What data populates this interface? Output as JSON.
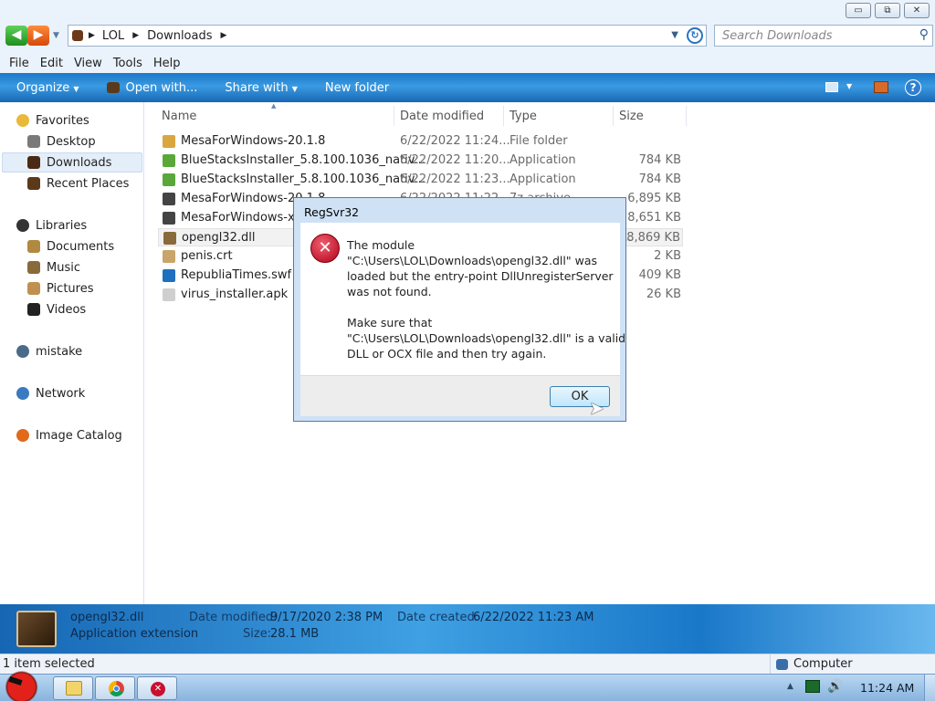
{
  "window": {
    "min": "▭",
    "max": "⧉",
    "close": "✕"
  },
  "address": {
    "crumbs": [
      "LOL",
      "Downloads"
    ],
    "search_placeholder": "Search Downloads"
  },
  "menu": [
    "File",
    "Edit",
    "View",
    "Tools",
    "Help"
  ],
  "toolbar": {
    "organize": "Organize",
    "open_with": "Open with...",
    "share_with": "Share with",
    "new_folder": "New folder"
  },
  "nav": {
    "favorites": "Favorites",
    "desktop": "Desktop",
    "downloads": "Downloads",
    "recent": "Recent Places",
    "libraries": "Libraries",
    "documents": "Documents",
    "music": "Music",
    "pictures": "Pictures",
    "videos": "Videos",
    "mistake": "mistake",
    "network": "Network",
    "image_catalog": "Image Catalog"
  },
  "columns": {
    "name": "Name",
    "date": "Date modified",
    "type": "Type",
    "size": "Size"
  },
  "files": [
    {
      "name": "MesaForWindows-20.1.8",
      "date": "6/22/2022 11:24...",
      "type": "File folder",
      "size": "",
      "color": "#d9a640"
    },
    {
      "name": "BlueStacksInstaller_5.8.100.1036_nativ...",
      "date": "6/22/2022 11:20...",
      "type": "Application",
      "size": "784 KB",
      "color": "#5aa83a"
    },
    {
      "name": "BlueStacksInstaller_5.8.100.1036_nativ...",
      "date": "6/22/2022 11:23...",
      "type": "Application",
      "size": "784 KB",
      "color": "#5aa83a"
    },
    {
      "name": "MesaForWindows-20.1.8",
      "date": "6/22/2022 11:22...",
      "type": "7z archive",
      "size": "6,895 KB",
      "color": "#444444"
    },
    {
      "name": "MesaForWindows-x64-20.1.8",
      "date": "6/22/2022 11:22...",
      "type": "7z archive",
      "size": "8,651 KB",
      "color": "#444444"
    },
    {
      "name": "opengl32.dll",
      "date": "9/17/2020 2:38 PM",
      "type": "Application extens...",
      "size": "28,869 KB",
      "color": "#8a6a3a"
    },
    {
      "name": "penis.crt",
      "date": "",
      "type": "",
      "size": "2 KB",
      "color": "#c9a56a"
    },
    {
      "name": "RepubliaTimes.swf",
      "date": "",
      "type": "",
      "size": "409 KB",
      "color": "#1f6fbf"
    },
    {
      "name": "virus_installer.apk",
      "date": "",
      "type": "",
      "size": "26 KB",
      "color": "#cfcfcf"
    }
  ],
  "details": {
    "name": "opengl32.dll",
    "kind": "Application extension",
    "date_modified_label": "Date modified:",
    "date_modified": "9/17/2020 2:38 PM",
    "size_label": "Size:",
    "size": "28.1 MB",
    "date_created_label": "Date created:",
    "date_created": "6/22/2022 11:23 AM"
  },
  "status": {
    "selected": "1 item selected",
    "location": "Computer"
  },
  "taskbar": {
    "clock": "11:24 AM"
  },
  "dialog": {
    "title": "RegSvr32",
    "line1": "The module",
    "line2": "\"C:\\Users\\LOL\\Downloads\\opengl32.dll\" was",
    "line3": "loaded but the entry-point DllUnregisterServer",
    "line4": "was not found.",
    "line5": "Make sure that",
    "line6": "\"C:\\Users\\LOL\\Downloads\\opengl32.dll\" is a valid",
    "line7": "DLL or OCX file and then try again.",
    "ok": "OK"
  },
  "colors": {
    "toolbar": "#2a8ad8",
    "accent": "#1666b3",
    "error": "#c8102e"
  }
}
